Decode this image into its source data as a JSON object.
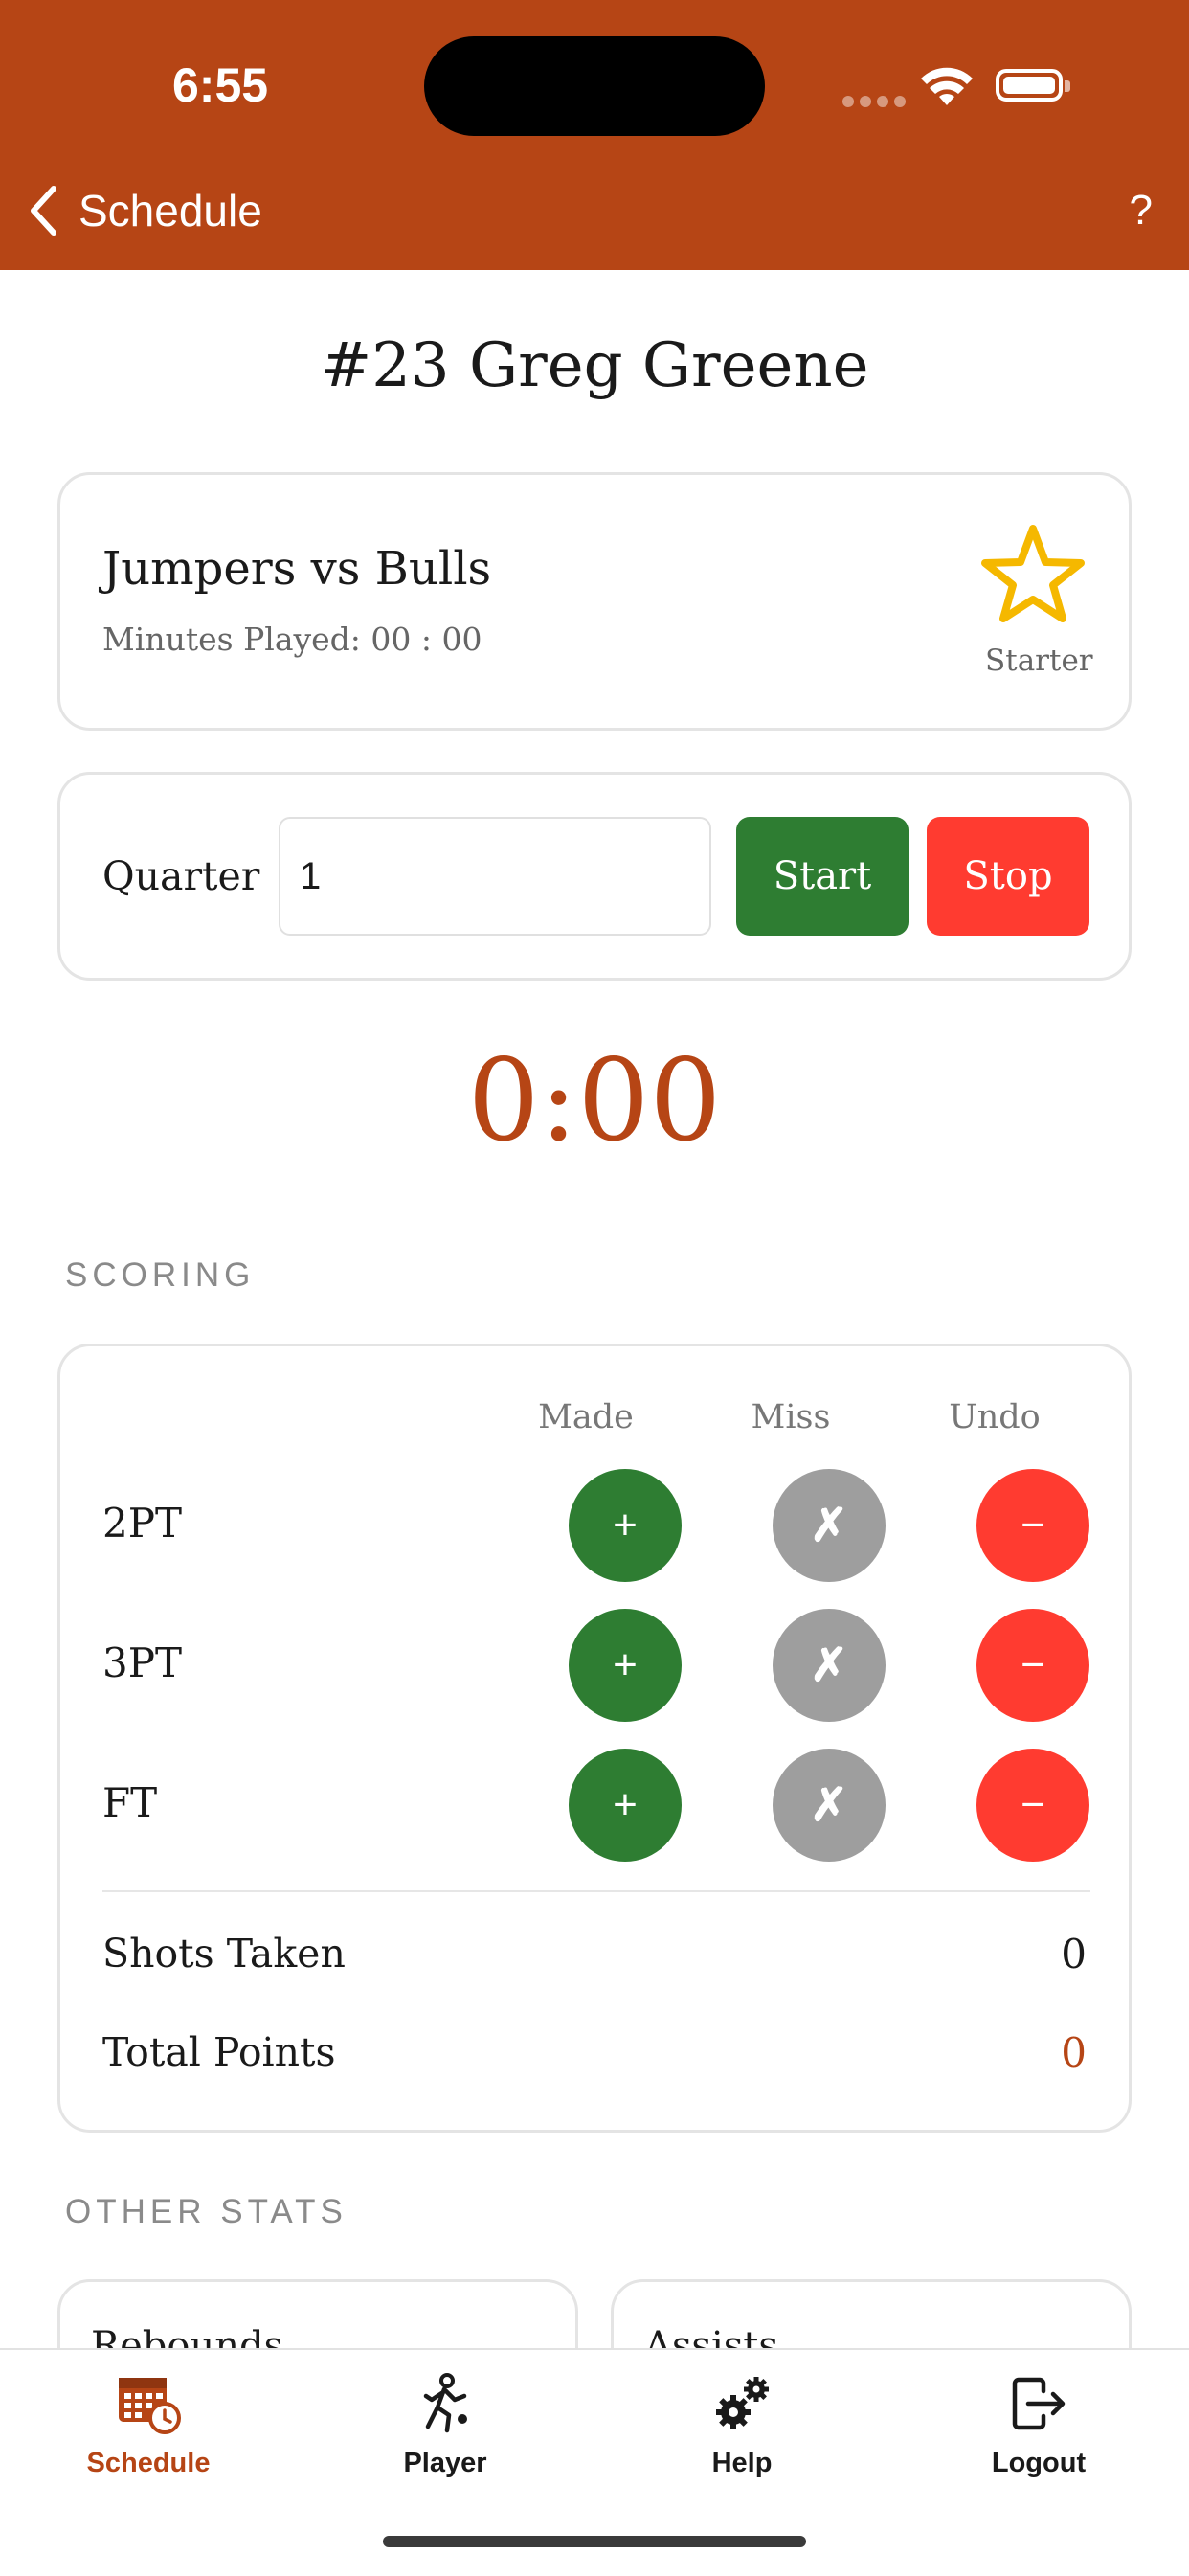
{
  "status_bar": {
    "time": "6:55"
  },
  "nav": {
    "back_label": "Schedule",
    "help_label": "?"
  },
  "player": {
    "title": "#23  Greg Greene"
  },
  "game": {
    "name": "Jumpers vs Bulls",
    "minutes_played": "Minutes Played: 00 : 00",
    "starter_label": "Starter"
  },
  "quarter": {
    "label": "Quarter",
    "value": "1",
    "start_label": "Start",
    "stop_label": "Stop"
  },
  "timer": {
    "display": "0:00"
  },
  "scoring": {
    "section_title": "SCORING",
    "columns": [
      "Made",
      "Miss",
      "Undo"
    ],
    "rows": [
      {
        "label": "2PT",
        "made": "+",
        "miss": "✗",
        "undo": "−"
      },
      {
        "label": "3PT",
        "made": "+",
        "miss": "✗",
        "undo": "−"
      },
      {
        "label": "FT",
        "made": "+",
        "miss": "✗",
        "undo": "−"
      }
    ],
    "shots_taken_label": "Shots Taken",
    "shots_taken_value": "0",
    "total_points_label": "Total Points",
    "total_points_value": "0"
  },
  "other_stats": {
    "section_title": "OTHER STATS",
    "cards": [
      "Rebounds",
      "Assists"
    ]
  },
  "tabs": [
    {
      "label": "Schedule",
      "icon": "calendar-clock-icon",
      "active": true
    },
    {
      "label": "Player",
      "icon": "running-player-icon",
      "active": false
    },
    {
      "label": "Help",
      "icon": "gears-icon",
      "active": false
    },
    {
      "label": "Logout",
      "icon": "logout-icon",
      "active": false
    }
  ],
  "colors": {
    "brand": "#B64515",
    "made": "#2E7D32",
    "miss": "#9E9E9E",
    "undo": "#FF3B30",
    "star": "#F5B800"
  }
}
